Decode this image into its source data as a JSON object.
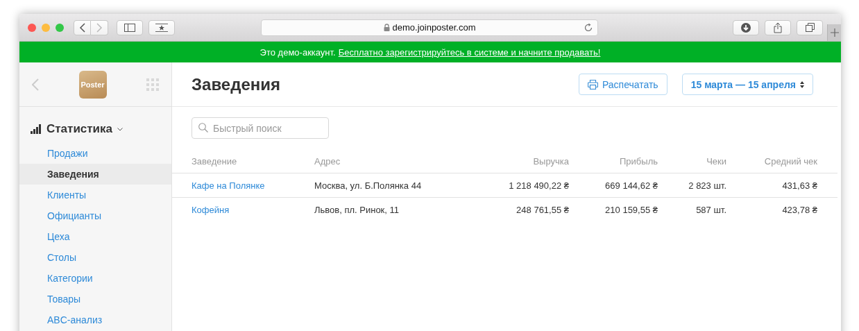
{
  "browser": {
    "url": "demo.joinposter.com"
  },
  "banner": {
    "text": "Это демо-аккаунт.",
    "link": "Бесплатно зарегистрируйтесь в системе и начните продавать!"
  },
  "logo": {
    "text": "Poster"
  },
  "sidebar": {
    "section": "Статистика",
    "items": [
      {
        "label": "Продажи",
        "selected": false
      },
      {
        "label": "Заведения",
        "selected": true
      },
      {
        "label": "Клиенты",
        "selected": false
      },
      {
        "label": "Официанты",
        "selected": false
      },
      {
        "label": "Цеха",
        "selected": false
      },
      {
        "label": "Столы",
        "selected": false
      },
      {
        "label": "Категории",
        "selected": false
      },
      {
        "label": "Товары",
        "selected": false
      },
      {
        "label": "ABC-анализ",
        "selected": false
      }
    ]
  },
  "page": {
    "title": "Заведения",
    "print_button": "Распечатать",
    "date_range": "15 марта — 15 апреля"
  },
  "search": {
    "placeholder": "Быстрый поиск"
  },
  "table": {
    "columns": [
      "Заведение",
      "Адрес",
      "Выручка",
      "Прибыль",
      "Чеки",
      "Средний чек"
    ],
    "rows": [
      [
        "Кафе на Полянке",
        "Москва, ул. Б.Полянка 44",
        "1 218 490,22 ₴",
        "669 144,62 ₴",
        "2 823 шт.",
        "431,63 ₴"
      ],
      [
        "Кофейня",
        "Львов, пл. Ринок, 11",
        "248 761,55 ₴",
        "210 159,55 ₴",
        "587 шт.",
        "423,78 ₴"
      ]
    ]
  }
}
